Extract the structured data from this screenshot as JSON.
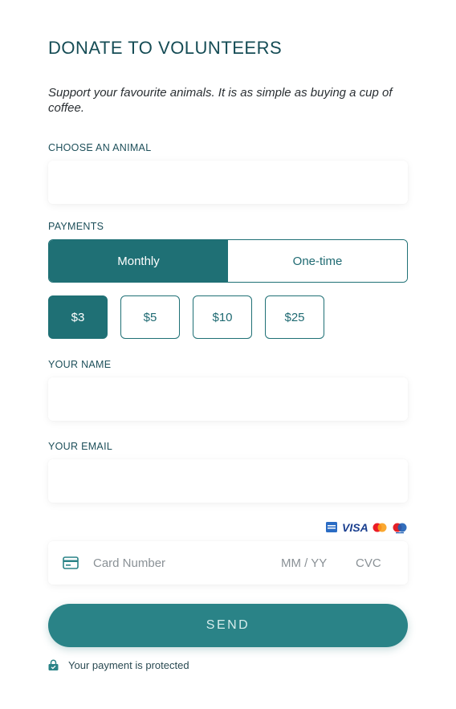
{
  "form": {
    "title": "DONATE TO VOLUNTEERS",
    "subtitle": "Support your favourite animals. It is as simple as buying a cup of coffee."
  },
  "animal": {
    "label": "CHOOSE AN ANIMAL",
    "value": ""
  },
  "payments": {
    "label": "PAYMENTS",
    "options": [
      "Monthly",
      "One-time"
    ],
    "selected": "Monthly",
    "amounts": [
      "$3",
      "$5",
      "$10",
      "$25"
    ],
    "selected_amount": "$3"
  },
  "name": {
    "label": "YOUR NAME",
    "value": ""
  },
  "email": {
    "label": "YOUR EMAIL",
    "value": ""
  },
  "card": {
    "brands": [
      "amex-icon",
      "visa-icon",
      "mastercard-icon",
      "maestro-icon"
    ],
    "visa_text": "VISA",
    "number_placeholder": "Card Number",
    "expiry_placeholder": "MM / YY",
    "cvc_placeholder": "CVC"
  },
  "submit": {
    "label": "SEND"
  },
  "footer": {
    "protected_text": "Your payment is protected"
  },
  "colors": {
    "primary": "#1f7075",
    "button": "#2a8387",
    "heading": "#154c55"
  }
}
